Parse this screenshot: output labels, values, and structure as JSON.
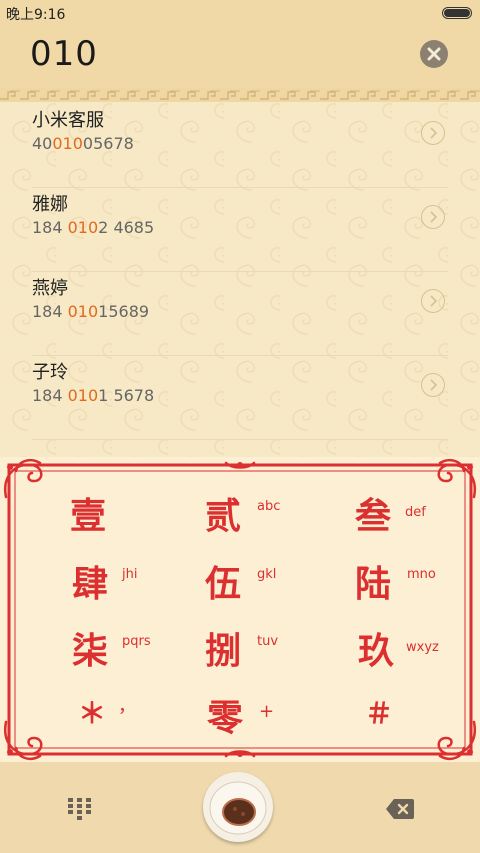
{
  "status_bar": {
    "time": "晚上9:16"
  },
  "search": {
    "query": "010"
  },
  "contacts": [
    {
      "name": "小米客服",
      "number_pre": "40",
      "number_hl": "010",
      "number_post": "05678"
    },
    {
      "name": "雅娜",
      "number_pre": "184 ",
      "number_hl": "010",
      "number_post": "2 4685"
    },
    {
      "name": "燕婷",
      "number_pre": "184 ",
      "number_hl": "010",
      "number_post": "15689"
    },
    {
      "name": "子玲",
      "number_pre": "184 ",
      "number_hl": "010",
      "number_post": "1 5678"
    }
  ],
  "keypad": [
    {
      "digit": "壹",
      "letters": ""
    },
    {
      "digit": "贰",
      "letters": "abc"
    },
    {
      "digit": "叁",
      "letters": "def"
    },
    {
      "digit": "肆",
      "letters": "jhi"
    },
    {
      "digit": "伍",
      "letters": "gkl"
    },
    {
      "digit": "陆",
      "letters": "mno"
    },
    {
      "digit": "柒",
      "letters": "pqrs"
    },
    {
      "digit": "捌",
      "letters": "tuv"
    },
    {
      "digit": "玖",
      "letters": "wxyz"
    },
    {
      "digit": "＊",
      "letters": "，"
    },
    {
      "digit": "零",
      "letters": "+"
    },
    {
      "digit": "＃",
      "letters": ""
    }
  ],
  "colors": {
    "accent": "#e06b1e",
    "keypad_red": "#dc2f2f",
    "background": "#f7e9c6"
  },
  "icons": {
    "clear": "close-circle-icon",
    "arrow": "chevron-right-circle-icon",
    "dialpad": "dialpad-grid-icon",
    "call": "call-bun-icon",
    "backspace": "backspace-icon"
  }
}
